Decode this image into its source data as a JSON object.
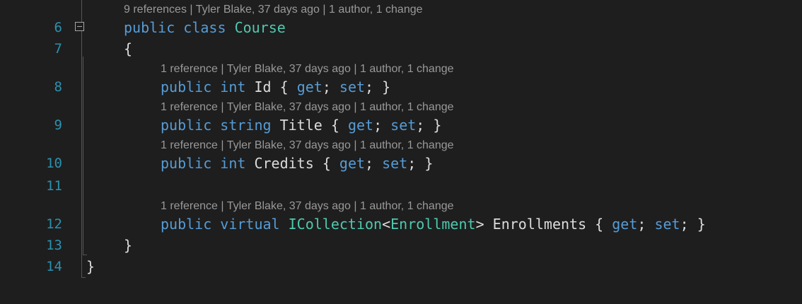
{
  "lines": [
    {
      "number": "6",
      "lens": {
        "refs": "9 references",
        "author": "Tyler Blake, 37 days ago",
        "changes": "1 author, 1 change"
      }
    },
    {
      "number": "7"
    },
    {
      "number": "8",
      "lens": {
        "refs": "1 reference",
        "author": "Tyler Blake, 37 days ago",
        "changes": "1 author, 1 change"
      }
    },
    {
      "number": "9",
      "lens": {
        "refs": "1 reference",
        "author": "Tyler Blake, 37 days ago",
        "changes": "1 author, 1 change"
      }
    },
    {
      "number": "10",
      "lens": {
        "refs": "1 reference",
        "author": "Tyler Blake, 37 days ago",
        "changes": "1 author, 1 change"
      }
    },
    {
      "number": "11"
    },
    {
      "number": "12",
      "lens": {
        "refs": "1 reference",
        "author": "Tyler Blake, 37 days ago",
        "changes": "1 author, 1 change"
      }
    },
    {
      "number": "13"
    },
    {
      "number": "14"
    }
  ],
  "tokens": {
    "public": "public",
    "class": "class",
    "int": "int",
    "string": "string",
    "virtual": "virtual",
    "get": "get",
    "set": "set",
    "course": "Course",
    "id": "Id",
    "title": "Title",
    "credits": "Credits",
    "icollection": "ICollection",
    "enrollment": "Enrollment",
    "enrollments": "Enrollments",
    "open_brace": "{",
    "close_brace": "}"
  },
  "lens_separator": " | ",
  "colors": {
    "background": "#1e1e1e",
    "keyword": "#569cd6",
    "type": "#4ec9b0",
    "line_number": "#2b91af",
    "text": "#dcdcdc",
    "codelens": "#999999"
  }
}
